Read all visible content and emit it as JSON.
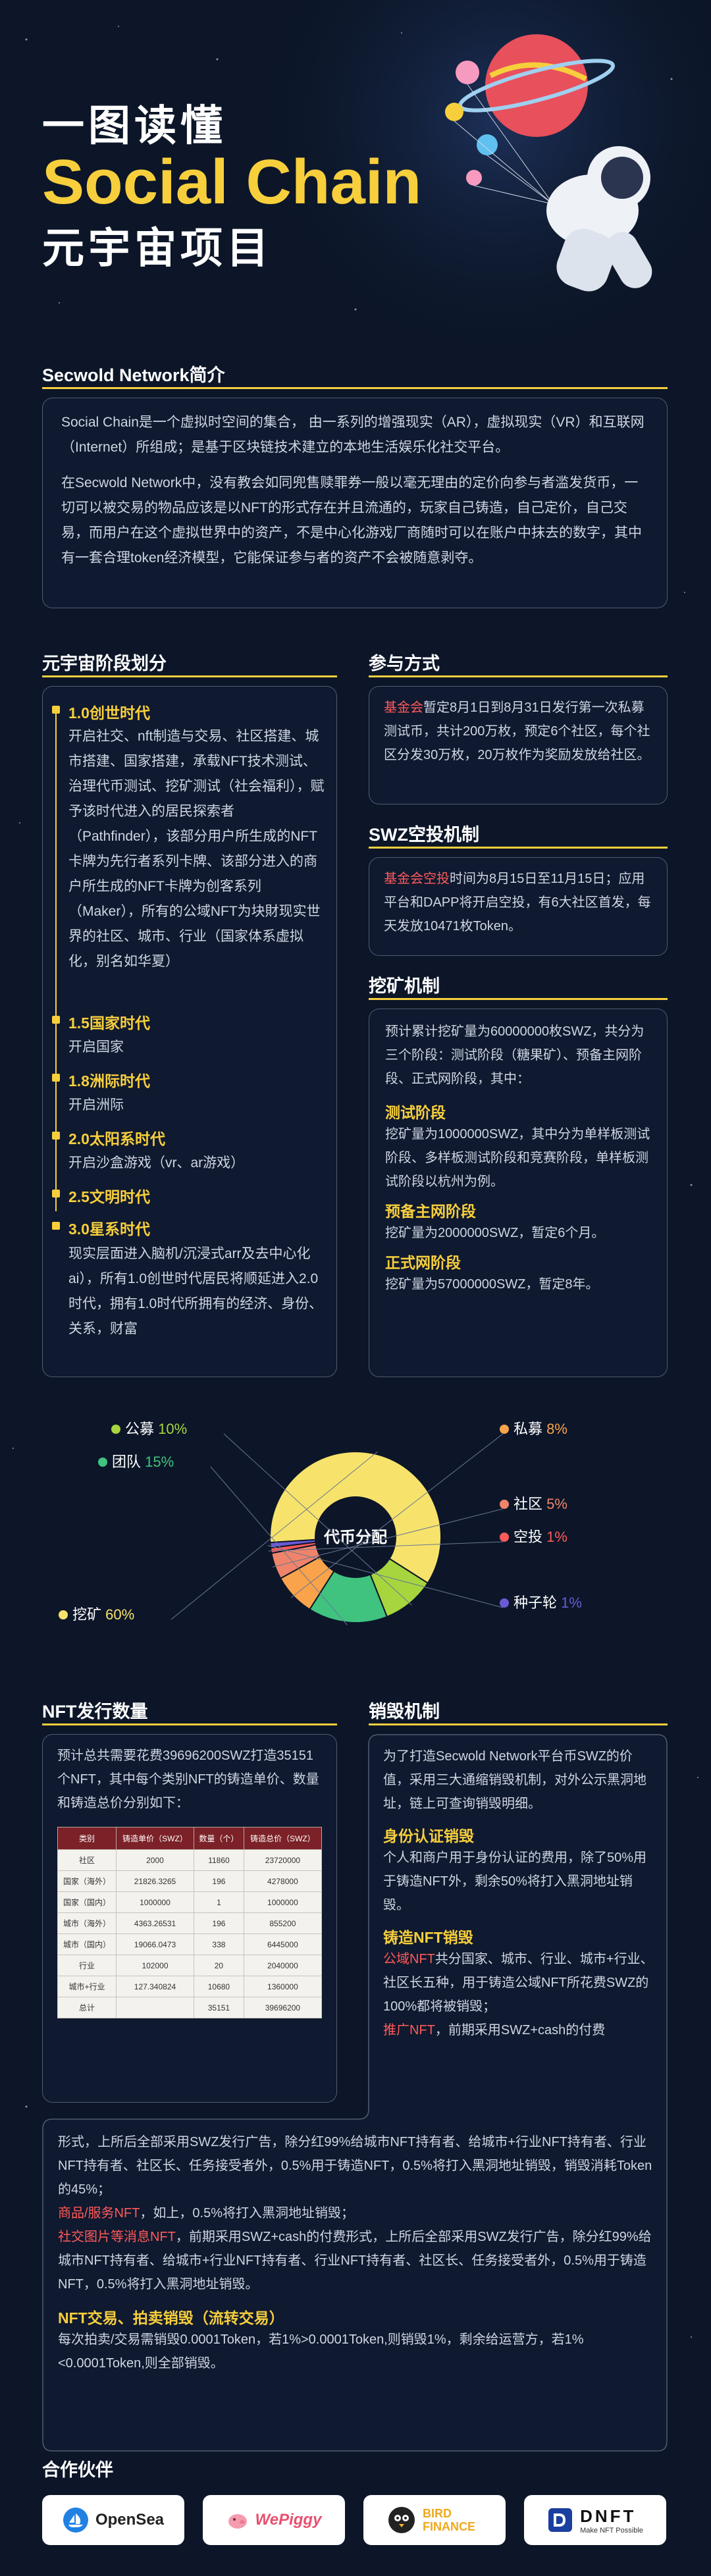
{
  "hero": {
    "line1": "一图读懂",
    "line2": "Social Chain",
    "line3": "元宇宙项目"
  },
  "intro": {
    "title": "Secwold Network简介",
    "para1": "Social Chain是一个虚拟时空间的集合， 由一系列的增强现实（AR），虚拟现实（VR）和互联网（Internet）所组成；是基于区块链技术建立的本地生活娱乐化社交平台。",
    "para2": "在Secwold Network中，没有教会如同兜售赎罪券一般以毫无理由的定价向参与者滥发货币，一切可以被交易的物品应该是以NFT的形式存在并且流通的，玩家自己铸造，自己定价，自己交易，而用户在这个虚拟世界中的资产，不是中心化游戏厂商随时可以在账户中抹去的数字，其中有一套合理token经济模型，它能保证参与者的资产不会被随意剥夺。"
  },
  "stages": {
    "title": "元宇宙阶段划分",
    "items": [
      {
        "title": "1.0创世时代",
        "desc": "开启社交、nft制造与交易、社区搭建、城市搭建、国家搭建，承载NFT技术测试、治理代币测试、挖矿测试（社会福利），赋予该时代进入的居民探索者（Pathfinder），该部分用户所生成的NFT卡牌为先行者系列卡牌、该部分进入的商户所生成的NFT卡牌为创客系列（Maker），所有的公域NFT为块財现实世界的社区、城市、行业（国家体系虚拟化，别名如华夏）"
      },
      {
        "title": "1.5国家时代",
        "desc": "开启国家"
      },
      {
        "title": "1.8洲际时代",
        "desc": "开启洲际"
      },
      {
        "title": "2.0太阳系时代",
        "desc": "开启沙盒游戏（vr、ar游戏）"
      },
      {
        "title": "2.5文明时代",
        "desc": ""
      },
      {
        "title": "3.0星系时代",
        "desc": "现实层面进入脑机/沉浸式arr及去中心化ai），所有1.0创世时代居民将顺延进入2.0时代，拥有1.0时代所拥有的经济、身份、关系，财富"
      }
    ]
  },
  "participation": {
    "title": "参与方式",
    "label": "基金会",
    "text": "暂定8月1日到8月31日发行第一次私募测试币，共计200万枚，预定6个社区，每个社区分发30万枚，20万枚作为奖励发放给社区。"
  },
  "airdrop": {
    "title": "SWZ空投机制",
    "label": "基金会空投",
    "text": "时间为8月15日至11月15日；应用平台和DAPP将开启空投，有6大社区首发，每天发放10471枚Token。"
  },
  "mining": {
    "title": "挖矿机制",
    "intro": "预计累计挖矿量为60000000枚SWZ，共分为三个阶段：测试阶段（糖果矿）、预备主网阶段、正式网阶段，其中：",
    "phases": [
      {
        "title": "测试阶段",
        "text": "挖矿量为1000000SWZ，其中分为单样板测试阶段、多样板测试阶段和竞赛阶段，单样板测试阶段以杭州为例。"
      },
      {
        "title": "预备主网阶段",
        "text": "挖矿量为2000000SWZ，暂定6个月。"
      },
      {
        "title": "正式网阶段",
        "text": "挖矿量为57000000SWZ，暂定8年。"
      }
    ]
  },
  "chart_data": {
    "type": "pie",
    "title": "代币分配",
    "categories": [
      "挖矿",
      "公募",
      "团队",
      "私募",
      "社区",
      "空投",
      "种子轮"
    ],
    "values": [
      60,
      10,
      15,
      8,
      5,
      1,
      1
    ],
    "labels": [
      "挖矿 60%",
      "公募 10%",
      "团队 15%",
      "私募 8%",
      "社区 5%",
      "空投 1%",
      "种子轮 1%"
    ],
    "colors": [
      "#f7e36b",
      "#a7d53e",
      "#3fc37f",
      "#f9a34a",
      "#f0846a",
      "#ff5a5a",
      "#6a5ad8"
    ]
  },
  "nft_issue": {
    "title": "NFT发行数量",
    "intro": "预计总共需要花费39696200SWZ打造35151个NFT，其中每个类别NFT的铸造单价、数量和铸造总价分别如下：",
    "headers": [
      "类别",
      "铸造单价（SWZ）",
      "数量（个）",
      "铸造总价（SWZ）"
    ],
    "rows": [
      [
        "社区",
        "2000",
        "11860",
        "23720000"
      ],
      [
        "国家（海外）",
        "21826.3265",
        "196",
        "4278000"
      ],
      [
        "国家（国内）",
        "1000000",
        "1",
        "1000000"
      ],
      [
        "城市（海外）",
        "4363.26531",
        "196",
        "855200"
      ],
      [
        "城市（国内）",
        "19066.0473",
        "338",
        "6445000"
      ],
      [
        "行业",
        "102000",
        "20",
        "2040000"
      ],
      [
        "城市+行业",
        "127.340824",
        "10680",
        "1360000"
      ],
      [
        "总计",
        "",
        "35151",
        "39696200"
      ]
    ]
  },
  "burn": {
    "title": "销毁机制",
    "intro": "为了打造Secwold Network平台币SWZ的价值，采用三大通缩销毁机制，对外公示黑洞地址，链上可查询销毁明细。",
    "identity_title": "身份认证销毁",
    "identity_text": "个人和商户用于身份认证的费用，除了50%用于铸造NFT外，剩余50%将打入黑洞地址销毁。",
    "mint_title": "铸造NFT销毁",
    "public_label": "公域NFT",
    "public_text": "共分国家、城市、行业、城市+行业、社区长五种，用于铸造公域NFT所花费SWZ的100%都将被销毁；",
    "promo_label": "推广NFT",
    "promo_text": "，前期采用SWZ+cash的付费",
    "promo_text2": "形式，上所后全部采用SWZ发行广告，除分红99%给城市NFT持有者、给城市+行业NFT持有者、行业NFT持有者、社区长、任务接受者外，0.5%用于铸造NFT，0.5%将打入黑洞地址销毁，销毁消耗Token的45%；",
    "goods_label": "商品/服务NFT",
    "goods_text": "，如上，0.5%将打入黑洞地址销毁；",
    "social_label": "社交图片等消息NFT",
    "social_text": "，前期采用SWZ+cash的付费形式，上所后全部采用SWZ发行广告，除分红99%给城市NFT持有者、给城市+行业NFT持有者、行业NFT持有者、社区长、任务接受者外，0.5%用于铸造NFT，0.5%将打入黑洞地址销毁。",
    "trade_title": "NFT交易、拍卖销毁（流转交易）",
    "trade_text": "每次拍卖/交易需销毁0.0001Token，若1%>0.0001Token,则销毁1%，剩余给运营方，若1%<0.0001Token,则全部销毁。"
  },
  "partners": {
    "title": "合作伙伴",
    "items": [
      "OpenSea",
      "WePiggy",
      "BIRD FINANCE",
      "DNFT"
    ],
    "dnft_sub": "Make NFT Possible"
  }
}
